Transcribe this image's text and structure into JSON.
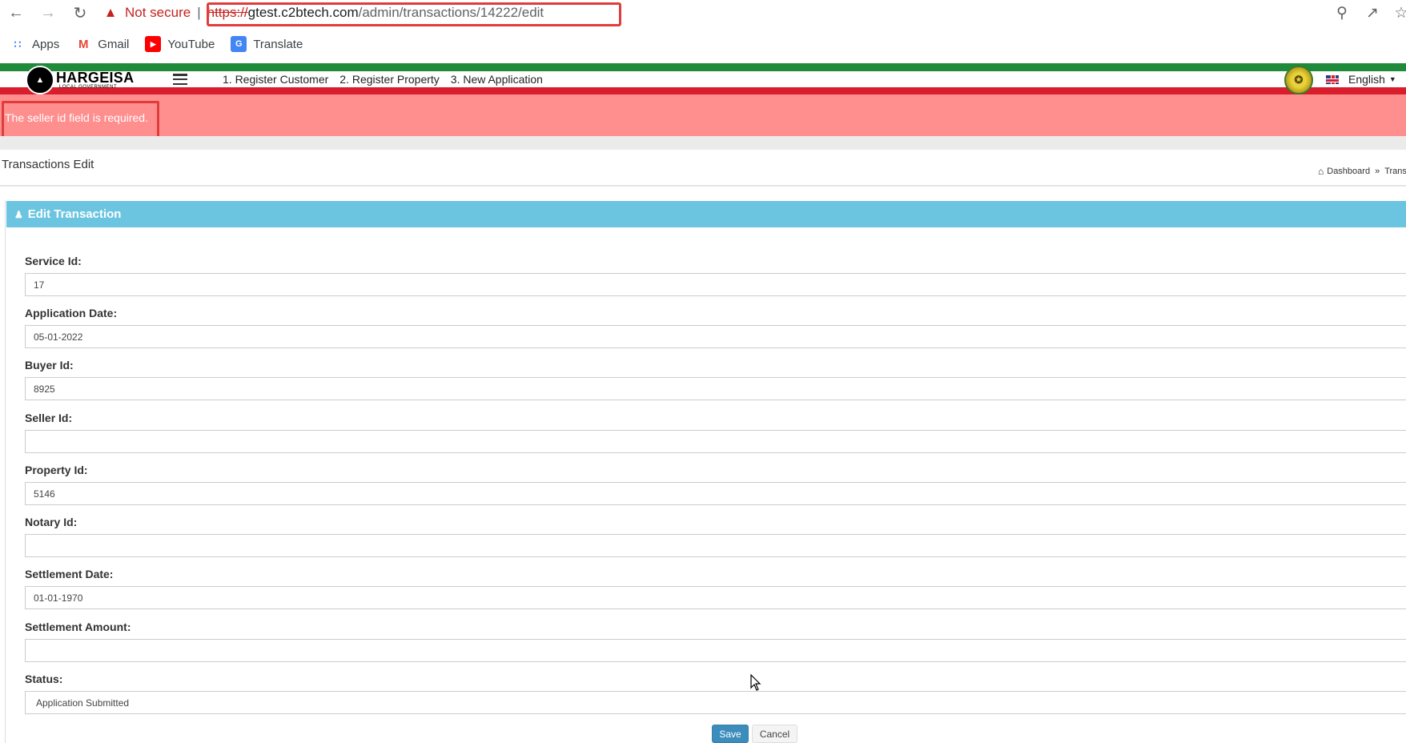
{
  "browser": {
    "security_label": "Not secure",
    "url_scheme": "https://",
    "url_host": "gtest.c2btech.com",
    "url_path": "/admin/transactions/14222/edit",
    "bookmarks": [
      {
        "label": "Apps",
        "icon": "apps-grid-icon"
      },
      {
        "label": "Gmail",
        "icon": "gmail-icon"
      },
      {
        "label": "YouTube",
        "icon": "youtube-icon"
      },
      {
        "label": "Translate",
        "icon": "translate-icon"
      }
    ]
  },
  "header": {
    "logo_main": "HARGEISA",
    "logo_sub": "LOCAL GOVERNMENT",
    "links": [
      "1. Register Customer",
      "2. Register Property",
      "3. New Application"
    ],
    "language": "English"
  },
  "alert": {
    "message": "The seller id field is required."
  },
  "page": {
    "title": "Transactions Edit",
    "breadcrumb": [
      "Dashboard",
      "Trans"
    ]
  },
  "panel": {
    "title": "Edit Transaction"
  },
  "form": {
    "fields": [
      {
        "label": "Service Id:",
        "value": "17"
      },
      {
        "label": "Application Date:",
        "value": "05-01-2022"
      },
      {
        "label": "Buyer Id:",
        "value": "8925"
      },
      {
        "label": "Seller Id:",
        "value": ""
      },
      {
        "label": "Property Id:",
        "value": "5146"
      },
      {
        "label": "Notary Id:",
        "value": ""
      },
      {
        "label": "Settlement Date:",
        "value": "01-01-1970"
      },
      {
        "label": "Settlement Amount:",
        "value": ""
      },
      {
        "label": "Status:",
        "value": "Application Submitted"
      }
    ],
    "save_label": "Save",
    "cancel_label": "Cancel"
  },
  "colors": {
    "header_green": "#1f8a3a",
    "header_red": "#d81e2c",
    "alert_bg": "#ff8f8f",
    "panel_head": "#6bc5e0",
    "save_button": "#3c8dbc"
  }
}
